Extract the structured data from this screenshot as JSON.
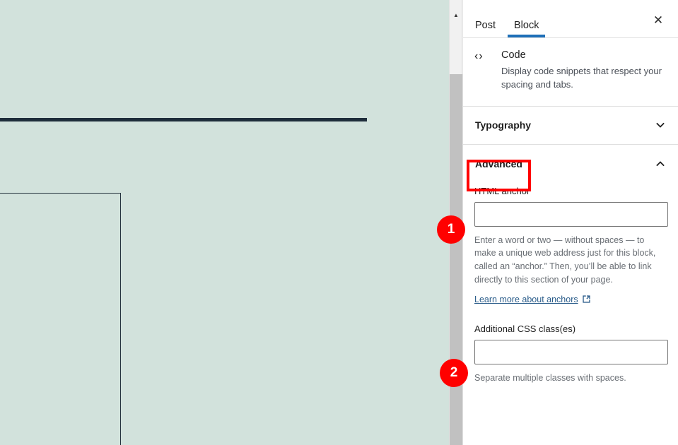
{
  "editor_canvas": {
    "name": "block-editor-canvas",
    "background_color": "#d2e2dc",
    "rule_color": "#1e2d3b",
    "placeholder_border_color": "#24323d"
  },
  "scrollbar": {
    "up_arrow_glyph": "▲",
    "track_color": "#f1f1f1",
    "thumb_color": "#c1c1c1"
  },
  "panel": {
    "tabs": [
      {
        "label": "Post",
        "active": false
      },
      {
        "label": "Block",
        "active": true
      }
    ],
    "active_tab_color": "#1e6fb8",
    "close_label": "✕",
    "block_card": {
      "icon": "code-icon",
      "icon_glyph": "‹›",
      "title": "Code",
      "description": "Display code snippets that respect your spacing and tabs."
    },
    "sections": [
      {
        "label": "Typography",
        "expanded": false,
        "chevron": "chevron-down-icon"
      },
      {
        "label": "Advanced",
        "expanded": true,
        "chevron": "chevron-up-icon",
        "highlighted": true,
        "highlight_color": "#ff0000"
      }
    ],
    "advanced": {
      "anchor_label": "HTML anchor",
      "anchor_value": "",
      "anchor_placeholder": "",
      "anchor_help": "Enter a word or two — without spaces — to make a unique web address just for this block, called an “anchor.” Then, you’ll be able to link directly to this section of your page.",
      "anchor_link_text": "Learn more about anchors",
      "anchor_link_icon": "external-link-icon",
      "css_label": "Additional CSS class(es)",
      "css_value": "",
      "css_placeholder": "",
      "css_help": "Separate multiple classes with spaces."
    }
  },
  "annotations": {
    "badges": [
      {
        "number": "1",
        "target": "html-anchor-input"
      },
      {
        "number": "2",
        "target": "additional-css-input"
      }
    ],
    "badge_color": "#ff0000"
  }
}
